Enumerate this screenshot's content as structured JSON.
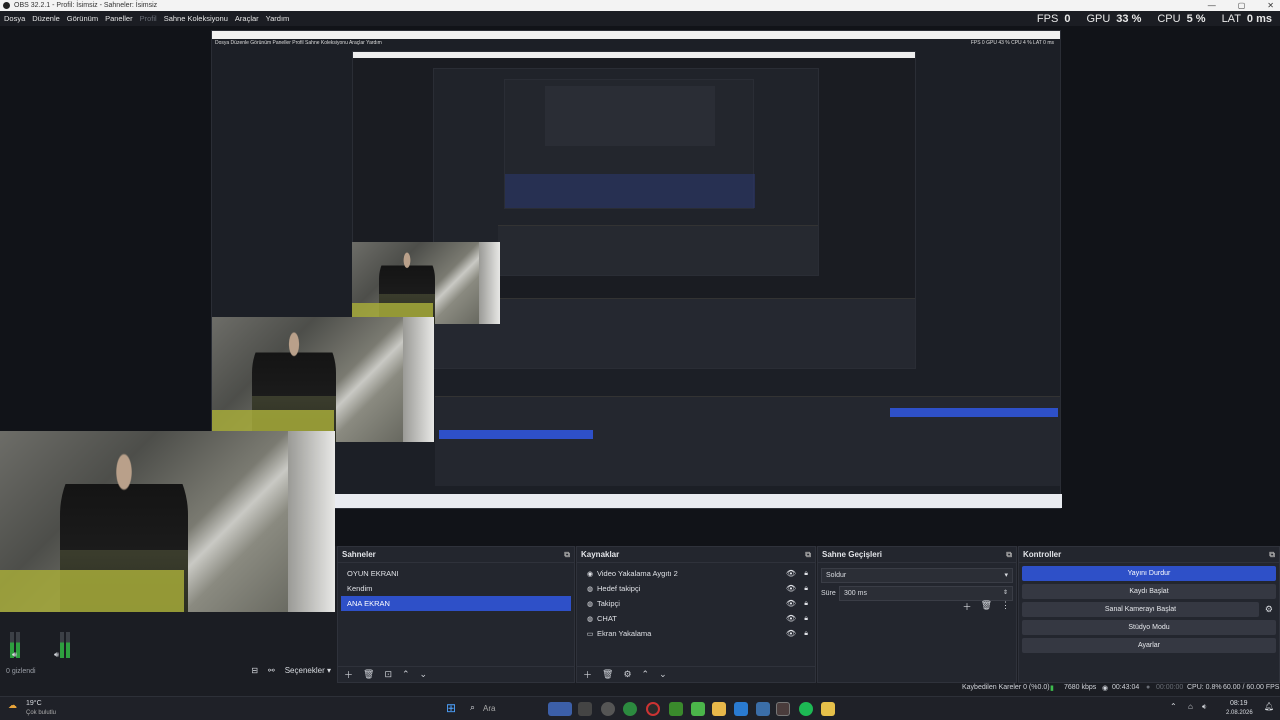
{
  "window": {
    "title": "OBS 32.2.1 - Profil: İsimsiz - Sahneler: İsimsiz",
    "minimize": "—",
    "maximize": "▢",
    "close": "✕"
  },
  "menu": {
    "items": [
      "Dosya",
      "Düzenle",
      "Görünüm",
      "Paneller",
      "Profil",
      "Sahne Koleksiyonu",
      "Araçlar",
      "Yardım"
    ]
  },
  "stats": {
    "fps_label": "FPS",
    "fps": "0",
    "gpu_label": "GPU",
    "gpu": "33 %",
    "cpu_label": "CPU",
    "cpu": "5 %",
    "lat_label": "LAT",
    "lat": "0 ms"
  },
  "nested": {
    "menu": "Dosya  Düzenle  Görünüm  Paneller  Profil  Sahne Koleksiyonu  Araçlar  Yardım",
    "stats": "FPS 0   GPU 43 %   CPU 4 %   LAT 0 ms"
  },
  "scenes": {
    "title": "Sahneler",
    "items": [
      "OYUN EKRANI",
      "Kendim",
      "ANA EKRAN"
    ],
    "selected": 2,
    "options_label": "Seçenekler"
  },
  "sources": {
    "title": "Kaynaklar",
    "items": [
      {
        "label": "Video Yakalama Aygıtı 2",
        "icon": "camera-icon"
      },
      {
        "label": "Hedef takipçi",
        "icon": "browser-icon"
      },
      {
        "label": "Takipçi",
        "icon": "browser-icon"
      },
      {
        "label": "CHAT",
        "icon": "browser-icon"
      },
      {
        "label": "Ekran Yakalama",
        "icon": "monitor-icon"
      }
    ]
  },
  "transitions": {
    "title": "Sahne Geçişleri",
    "type": "Soldur",
    "duration_label": "Süre",
    "duration": "300 ms"
  },
  "controls": {
    "title": "Kontroller",
    "stop_stream": "Yayını Durdur",
    "start_record": "Kaydı Başlat",
    "virtual_cam": "Sanal Kamerayı Başlat",
    "studio_mode": "Stüdyo Modu",
    "settings": "Ayarlar"
  },
  "mixer": {
    "hidden": "0 gizlendi"
  },
  "status": {
    "dropped": "Kaybedilen Kareler 0 (%0.0)",
    "kbps": "7680 kbps",
    "stream_time": "00:43:04",
    "rec_time": "00:00:00",
    "cpu": "CPU: 0.8%",
    "fps": "60.00 / 60.00 FPS"
  },
  "taskbar": {
    "weather_temp": "19°C",
    "weather_desc": "Çok bulutlu",
    "search_placeholder": "Ara",
    "clock": "08:19",
    "date": "2.08.2026"
  }
}
